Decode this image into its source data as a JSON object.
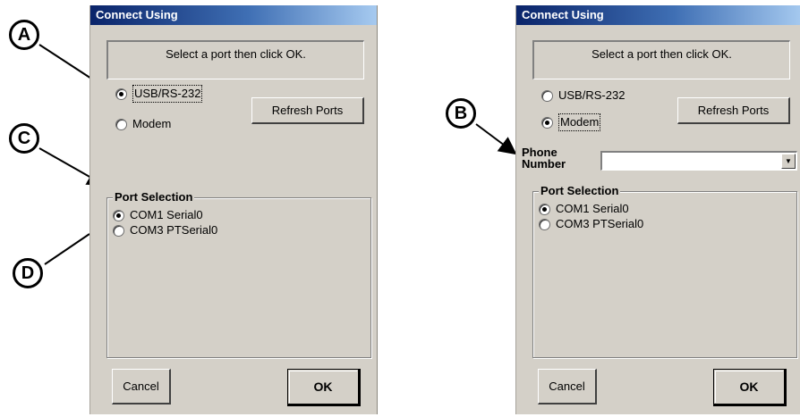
{
  "dialogs": [
    {
      "title": "Connect Using",
      "prompt": "Select a port then click OK.",
      "connection_options": [
        {
          "label": "USB/RS-232",
          "selected": true
        },
        {
          "label": "Modem",
          "selected": false
        }
      ],
      "refresh_button": "Refresh Ports",
      "port_group_title": "Port Selection",
      "ports": [
        {
          "label": "COM1 Serial0",
          "selected": true
        },
        {
          "label": "COM3 PTSerial0",
          "selected": false
        }
      ],
      "cancel_button": "Cancel",
      "ok_button": "OK"
    },
    {
      "title": "Connect Using",
      "prompt": "Select a port then click OK.",
      "connection_options": [
        {
          "label": "USB/RS-232",
          "selected": false
        },
        {
          "label": "Modem",
          "selected": true
        }
      ],
      "refresh_button": "Refresh Ports",
      "phone_label_line1": "Phone",
      "phone_label_line2": "Number",
      "phone_value": "",
      "port_group_title": "Port Selection",
      "ports": [
        {
          "label": "COM1 Serial0",
          "selected": true
        },
        {
          "label": "COM3 PTSerial0",
          "selected": false
        }
      ],
      "cancel_button": "Cancel",
      "ok_button": "OK"
    }
  ],
  "callouts": {
    "a": "A",
    "b": "B",
    "c": "C",
    "d": "D"
  },
  "icons": {
    "dropdown": "chevron-down-icon"
  }
}
